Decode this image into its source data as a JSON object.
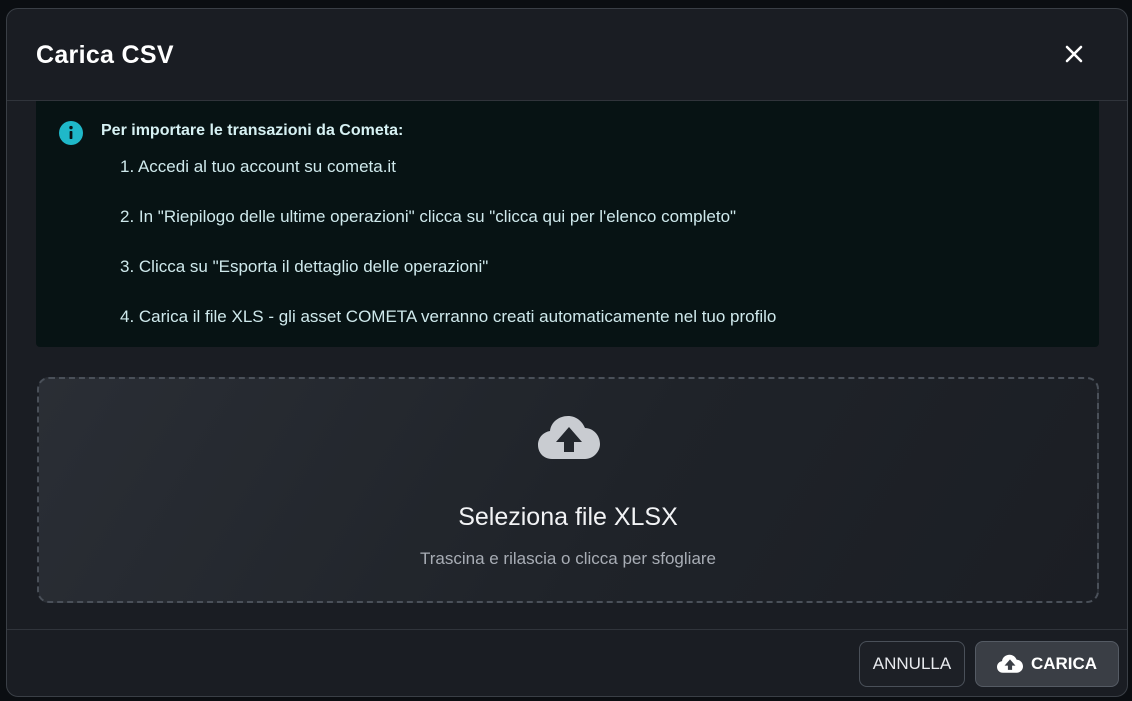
{
  "dialog": {
    "title": "Carica CSV",
    "close_icon": "close-icon"
  },
  "info": {
    "icon": "info-icon",
    "accent_color": "#1fb8c9",
    "title": "Per importare le transazioni da Cometa:",
    "steps": [
      "1. Accedi al tuo account su cometa.it",
      "2. In \"Riepilogo delle ultime operazioni\" clicca su \"clicca qui per l'elenco completo\"",
      "3. Clicca su \"Esporta il dettaglio delle operazioni\"",
      "4. Carica il file XLS - gli asset COMETA verranno creati automaticamente nel tuo profilo"
    ]
  },
  "dropzone": {
    "icon": "cloud-upload-icon",
    "title": "Seleziona file XLSX",
    "subtitle": "Trascina e rilascia o clicca per sfogliare"
  },
  "footer": {
    "cancel_label": "ANNULLA",
    "upload_label": "CARICA",
    "upload_icon": "cloud-upload-icon"
  }
}
